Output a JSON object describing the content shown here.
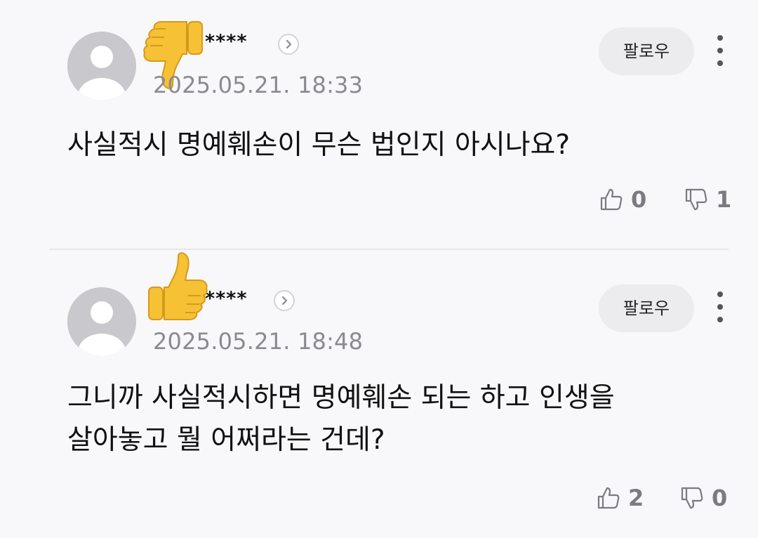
{
  "comments": [
    {
      "nickname": "****",
      "timestamp": "2025.05.21. 18:33",
      "follow_label": "팔로우",
      "body_lines": [
        "사실적시 명예훼손이 무슨 법인지 아시나요?"
      ],
      "likes": "0",
      "dislikes": "1",
      "overlay_emoji": "thumbs-down-emoji"
    },
    {
      "nickname": "****",
      "timestamp": "2025.05.21. 18:48",
      "follow_label": "팔로우",
      "body_lines": [
        "그니까 사실적시하면 명예훼손 되는 하고 인생을",
        "살아놓고 뭘 어쩌라는 건데?"
      ],
      "likes": "2",
      "dislikes": "0",
      "overlay_emoji": "thumbs-up-emoji"
    }
  ],
  "colors": {
    "background": "#f8f8fa",
    "avatar": "#c9c9cd",
    "muted_text": "#8a8a8f",
    "follow_button_bg": "#ececee",
    "emoji_yellow": "#f7c136"
  }
}
